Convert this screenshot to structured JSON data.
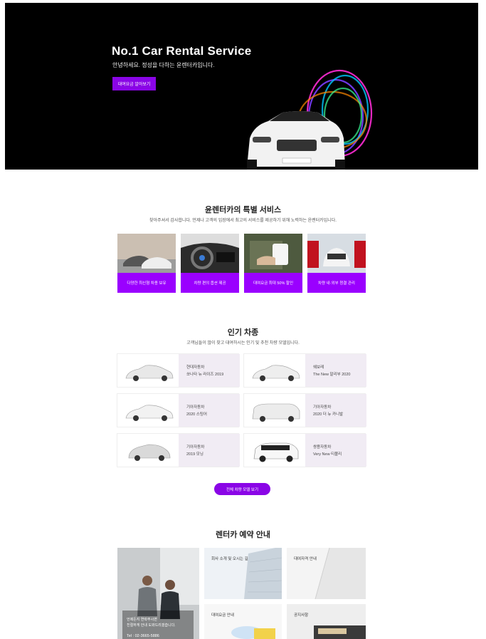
{
  "hero": {
    "title": "No.1 Car Rental Service",
    "subtitle": "안녕하세요. 정성을 다하는 윤렌터카입니다.",
    "cta_label": "대여요금 알아보기"
  },
  "services": {
    "title": "윤렌터카의 특별 서비스",
    "subtitle": "찾아주셔서 감사합니다. 언제나 고객의 입장에서 최고의 서비스를 제공하기 위해 노력하는 윤렌터카입니다.",
    "items": [
      {
        "label": "다양한 최신형 차종 보유"
      },
      {
        "label": "차량 편의 옵션 제공"
      },
      {
        "label": "대여요금 최대 50% 할인"
      },
      {
        "label": "차량 내·외부 청결 관리"
      }
    ]
  },
  "popular": {
    "title": "인기 차종",
    "subtitle": "고객님들이 많이 찾고 대여하시는 인기 및 추천 차량 모델입니다.",
    "cars": [
      {
        "maker": "현대자동차",
        "model": "쏘나타 뉴 라이즈 2019"
      },
      {
        "maker": "쉐보레",
        "model": "The New 말리부 2020"
      },
      {
        "maker": "기아자동차",
        "model": "2020 스팅어"
      },
      {
        "maker": "기아자동차",
        "model": "2020 더 뉴 카니발"
      },
      {
        "maker": "기아자동차",
        "model": "2019 모닝"
      },
      {
        "maker": "쌍용자동차",
        "model": "Very New 티볼리"
      }
    ],
    "more_label": "전체 차량 모델 보기"
  },
  "reservation": {
    "title": "렌터카 예약 안내",
    "main_text_1": "언제든지 연락주시면",
    "main_text_2": "친절하게 안내 도와드리겠습니다.",
    "phone": "Tel : 02-3665-5886",
    "tiles": [
      {
        "label": "회사 소개 및 오시는 길"
      },
      {
        "label": "대여자격 안내"
      },
      {
        "label": "대여요금 안내"
      },
      {
        "label": "공지사항"
      }
    ]
  },
  "colors": {
    "accent": "#8a05e6",
    "service_label_bg": "#9a00ff",
    "car_info_bg": "#f1ecf4"
  }
}
